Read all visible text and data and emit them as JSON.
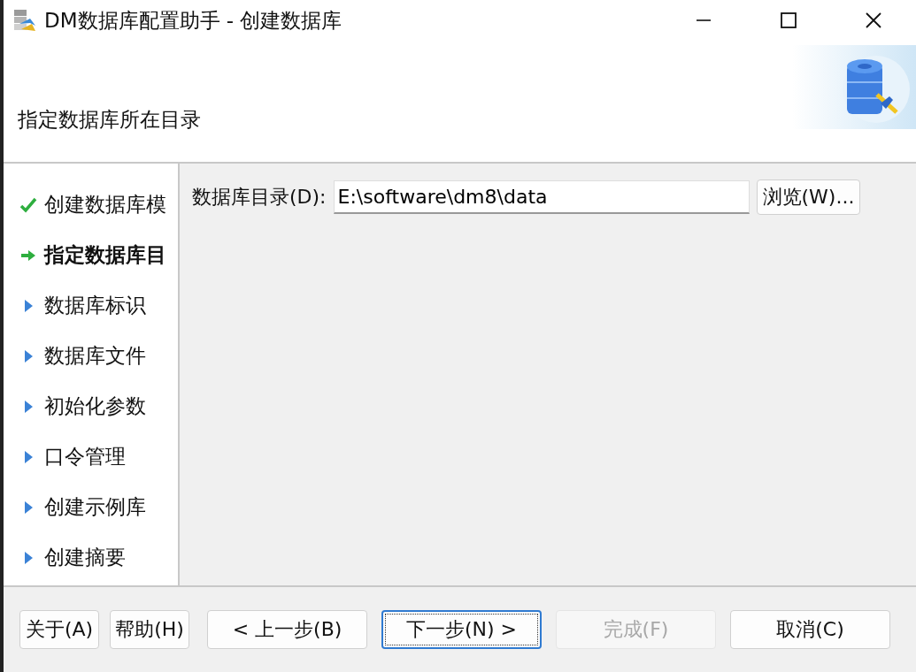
{
  "window": {
    "title": "DM数据库配置助手 - 创建数据库"
  },
  "header": {
    "subtitle": "指定数据库所在目录"
  },
  "steps": [
    {
      "label": "创建数据库模",
      "kind": "done"
    },
    {
      "label": "指定数据库目",
      "kind": "current"
    },
    {
      "label": "数据库标识",
      "kind": "pending"
    },
    {
      "label": "数据库文件",
      "kind": "pending"
    },
    {
      "label": "初始化参数",
      "kind": "pending"
    },
    {
      "label": "口令管理",
      "kind": "pending"
    },
    {
      "label": "创建示例库",
      "kind": "pending"
    },
    {
      "label": "创建摘要",
      "kind": "pending"
    }
  ],
  "form": {
    "label": "数据库目录(D):",
    "value": "E:\\software\\dm8\\data",
    "browse": "浏览(W)..."
  },
  "buttons": [
    {
      "label": "关于(A)",
      "kind": "small",
      "disabled": false,
      "focused": false
    },
    {
      "label": "帮助(H)",
      "kind": "small",
      "disabled": false,
      "focused": false
    },
    {
      "label": "< 上一步(B)",
      "kind": "wide",
      "disabled": false,
      "focused": false
    },
    {
      "label": "下一步(N) >",
      "kind": "wide",
      "disabled": false,
      "focused": true
    },
    {
      "label": "完成(F)",
      "kind": "wide",
      "disabled": true,
      "focused": false
    },
    {
      "label": "取消(C)",
      "kind": "wide",
      "disabled": false,
      "focused": false
    }
  ]
}
